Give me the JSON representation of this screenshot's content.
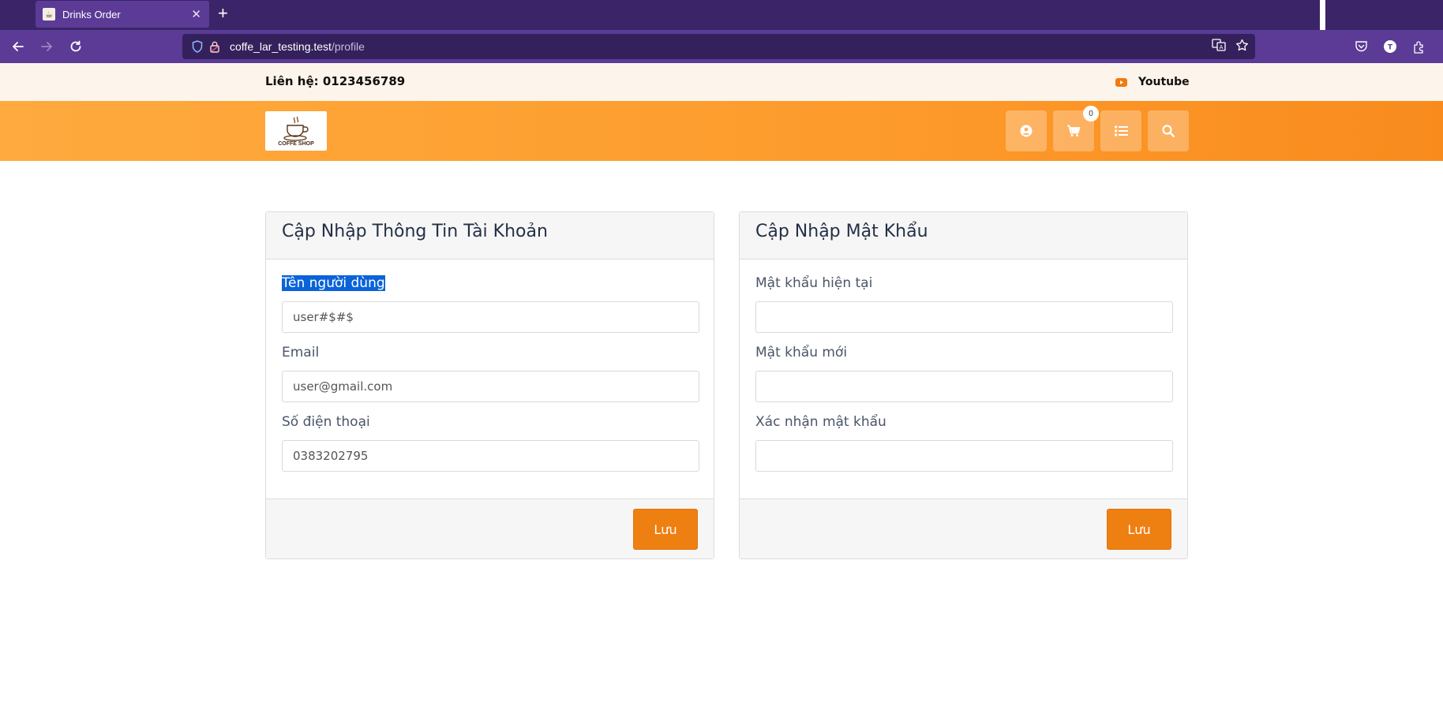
{
  "browser": {
    "tab_title": "Drinks Order",
    "url_host": "coffe_lar_testing.test",
    "url_path": "/profile"
  },
  "topbar": {
    "contact": "Liên hệ: 0123456789",
    "youtube_label": "Youtube"
  },
  "header": {
    "logo_text": "COFFE SHOP",
    "cart_count": "0"
  },
  "account_form": {
    "title": "Cập Nhập Thông Tin Tài Khoản",
    "username_label": "Tên người dùng",
    "username_value": "user#$#$",
    "email_label": "Email",
    "email_value": "user@gmail.com",
    "phone_label": "Số điện thoại",
    "phone_value": "0383202795",
    "save_label": "Lưu"
  },
  "password_form": {
    "title": "Cập Nhập Mật Khẩu",
    "current_label": "Mật khẩu hiện tại",
    "new_label": "Mật khẩu mới",
    "confirm_label": "Xác nhận mật khẩu",
    "save_label": "Lưu"
  },
  "colors": {
    "browser_frame": "#3b2568",
    "browser_toolbar": "#5b3b96",
    "header_orange": "#fd9b2c",
    "button_orange": "#ee7f11",
    "topbar_bg": "#fdf5ec"
  }
}
